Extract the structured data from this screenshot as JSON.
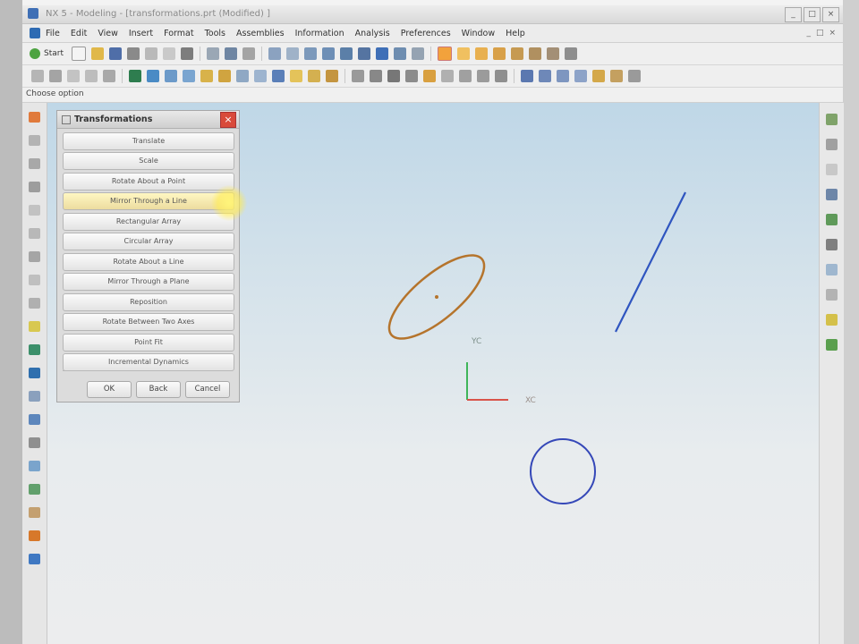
{
  "window": {
    "title": "NX 5 - Modeling - [transformations.prt (Modified) ]",
    "controls": [
      "_",
      "□",
      "×"
    ]
  },
  "menubar": {
    "items": [
      "File",
      "Edit",
      "View",
      "Insert",
      "Format",
      "Tools",
      "Assemblies",
      "Information",
      "Analysis",
      "Preferences",
      "Window",
      "Help"
    ],
    "right_controls": [
      "_",
      "□",
      "×"
    ]
  },
  "toolbar": {
    "start_label": "Start"
  },
  "cue_line": {
    "text": "Choose option"
  },
  "dialog": {
    "title": "Transformations",
    "close": "×",
    "options": [
      "Translate",
      "Scale",
      "Rotate About a Point",
      "Mirror Through a Line",
      "Rectangular Array",
      "Circular Array",
      "Rotate About a Line",
      "Mirror Through a Plane",
      "Reposition",
      "Rotate Between Two Axes",
      "Point Fit",
      "Incremental Dynamics"
    ],
    "highlighted_option": "Mirror Through a Line",
    "footer": {
      "ok": "OK",
      "back": "Back",
      "cancel": "Cancel"
    }
  },
  "graphics": {
    "axis_labels": {
      "x": "XC",
      "y": "YC"
    },
    "colors": {
      "ellipse": "#b5742c",
      "line": "#2f55c0",
      "circle": "#3548b8",
      "axis_x": "#d9534a",
      "axis_y": "#3fb55a"
    }
  },
  "icons": {
    "left_toolbar": [
      "select-icon",
      "line-icon",
      "arc-icon",
      "circle-icon",
      "point-icon",
      "plane-icon",
      "fillet-icon",
      "spline-icon",
      "layer-icon",
      "view-icon"
    ],
    "right_toolbar": [
      "navigator-icon",
      "history-icon",
      "palette-icon",
      "roles-icon",
      "web-icon",
      "settings-icon"
    ]
  }
}
